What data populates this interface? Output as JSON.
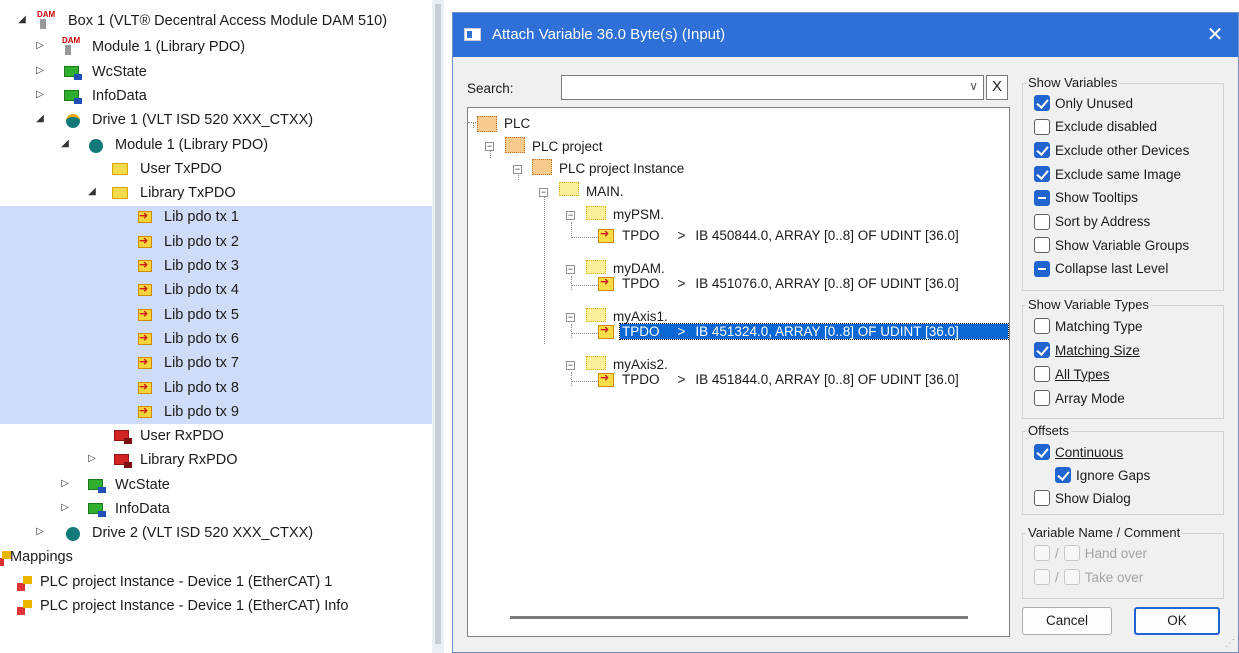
{
  "left_tree": {
    "items": [
      {
        "label": "Box 1 (VLT® Decentral Access Module DAM 510)",
        "icon": "dam-box-icon"
      },
      {
        "label": "Module 1 (Library PDO)",
        "icon": "dam-module-icon"
      },
      {
        "label": "WcState",
        "icon": "input-image-icon"
      },
      {
        "label": "InfoData",
        "icon": "input-image-icon"
      },
      {
        "label": "Drive 1 (VLT ISD 520 XXX_CTXX)",
        "icon": "drive-icon"
      },
      {
        "label": "Module 1 (Library PDO)",
        "icon": "drive-module-icon"
      },
      {
        "label": "User TxPDO",
        "icon": "folder-icon"
      },
      {
        "label": "Library TxPDO",
        "icon": "folder-icon"
      },
      {
        "label": "Lib pdo tx 1",
        "icon": "pdo-icon"
      },
      {
        "label": "Lib pdo tx 2",
        "icon": "pdo-icon"
      },
      {
        "label": "Lib pdo tx 3",
        "icon": "pdo-icon"
      },
      {
        "label": "Lib pdo tx 4",
        "icon": "pdo-icon"
      },
      {
        "label": "Lib pdo tx 5",
        "icon": "pdo-icon"
      },
      {
        "label": "Lib pdo tx 6",
        "icon": "pdo-icon"
      },
      {
        "label": "Lib pdo tx 7",
        "icon": "pdo-icon"
      },
      {
        "label": "Lib pdo tx 8",
        "icon": "pdo-icon"
      },
      {
        "label": "Lib pdo tx 9",
        "icon": "pdo-icon"
      },
      {
        "label": "User RxPDO",
        "icon": "output-image-icon"
      },
      {
        "label": "Library RxPDO",
        "icon": "output-image-icon"
      },
      {
        "label": "WcState",
        "icon": "input-image-icon"
      },
      {
        "label": "InfoData",
        "icon": "input-image-icon"
      },
      {
        "label": "Drive 2 (VLT ISD 520 XXX_CTXX)",
        "icon": "drive-icon"
      },
      {
        "label": "Mappings",
        "icon": "mappings-icon"
      },
      {
        "label": "PLC project Instance - Device 1 (EtherCAT) 1",
        "icon": "mapping-icon"
      },
      {
        "label": "PLC project Instance - Device 1 (EtherCAT) Info",
        "icon": "mapping-icon"
      }
    ]
  },
  "dialog": {
    "title": "Attach Variable 36.0 Byte(s) (Input)",
    "close_glyph": "✕",
    "search_label": "Search:",
    "search_value": "",
    "search_clear": "X",
    "tree": {
      "plc": "PLC",
      "project": "PLC project",
      "instance": "PLC project Instance",
      "main": "MAIN.",
      "groups": [
        {
          "name": "myPSM.",
          "var": "TPDO",
          "sep": ">",
          "info": "IB 450844.0, ARRAY [0..8] OF UDINT [36.0]"
        },
        {
          "name": "myDAM.",
          "var": "TPDO",
          "sep": ">",
          "info": "IB 451076.0, ARRAY [0..8] OF UDINT [36.0]"
        },
        {
          "name": "myAxis1.",
          "var": "TPDO",
          "sep": ">",
          "info": "IB 451324.0, ARRAY [0..8] OF UDINT [36.0]"
        },
        {
          "name": "myAxis2.",
          "var": "TPDO",
          "sep": ">",
          "info": "IB 451844.0, ARRAY [0..8] OF UDINT [36.0]"
        }
      ]
    },
    "show_variables": {
      "title": "Show Variables",
      "options": [
        {
          "label": "Only Unused",
          "state": "checked"
        },
        {
          "label": "Exclude disabled",
          "state": "unchecked"
        },
        {
          "label": "Exclude other Devices",
          "state": "checked"
        },
        {
          "label": "Exclude same Image",
          "state": "checked"
        },
        {
          "label": "Show Tooltips",
          "state": "indeterminate"
        },
        {
          "label": "Sort by Address",
          "state": "unchecked"
        },
        {
          "label": "Show Variable Groups",
          "state": "unchecked"
        },
        {
          "label": "Collapse last Level",
          "state": "indeterminate"
        }
      ]
    },
    "show_types": {
      "title": "Show Variable Types",
      "options": [
        {
          "label": "Matching Type",
          "state": "unchecked"
        },
        {
          "label": "Matching Size",
          "state": "checked"
        },
        {
          "label": "All Types",
          "state": "unchecked"
        },
        {
          "label": "Array Mode",
          "state": "unchecked"
        }
      ]
    },
    "offsets": {
      "title": "Offsets",
      "continuous": "Continuous",
      "ignore_gaps": "Ignore Gaps",
      "show_dialog": "Show Dialog"
    },
    "var_name": {
      "title": "Variable Name / Comment",
      "slash": "/",
      "hand_over": "Hand over",
      "take_over": "Take over"
    },
    "cancel": "Cancel",
    "ok": "OK"
  }
}
